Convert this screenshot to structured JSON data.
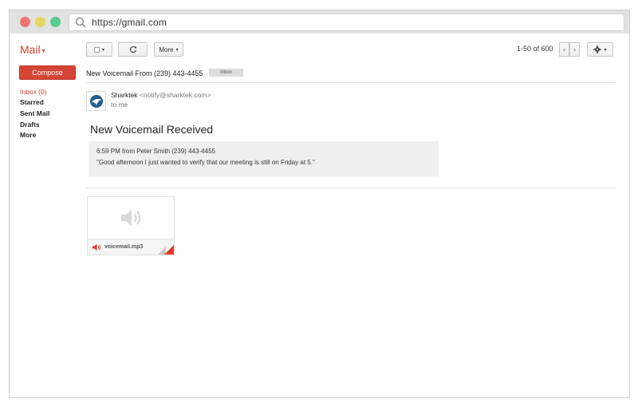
{
  "browser": {
    "url": "https://gmail.com"
  },
  "app": {
    "name": "Mail",
    "caret": "▾"
  },
  "toolbar": {
    "select_caret": "▾",
    "refresh_glyph": "⟳",
    "more_label": "More",
    "more_caret": "▾",
    "pager_text": "1-50 of 600",
    "prev_glyph": "‹",
    "next_glyph": "›",
    "settings_caret": "▾"
  },
  "sidebar": {
    "compose_label": "Compose",
    "items": [
      {
        "label": "Inbox (0)",
        "active": true
      },
      {
        "label": "Starred",
        "active": false
      },
      {
        "label": "Sent Mail",
        "active": false
      },
      {
        "label": "Drafts",
        "active": false
      },
      {
        "label": "More",
        "active": false
      }
    ]
  },
  "message": {
    "subject": "New Voicemail From (239) 443-4455",
    "label_tag": "Inbox",
    "sender_name": "Sharktek",
    "sender_email": "<notify@sharktek.com>",
    "recipient": "to me",
    "body_title": "New Voicemail Received",
    "voicemail_meta": "6:59 PM from Peter Smith (239) 443-4455",
    "voicemail_transcript": "\"Good afternoon I just wanted to verify that our meeting is still on Friday at 5.\""
  },
  "attachment": {
    "filename": "voicemail.mp3"
  },
  "colors": {
    "accent": "#d54535",
    "accent_text": "#d23f31",
    "titlebar": "#e2e2e2",
    "dot_red": "#ed7571",
    "dot_yellow": "#e6d663",
    "dot_green": "#56cc8c",
    "voicemail_box": "#efefef"
  },
  "icons": {
    "url_search": "search-icon",
    "refresh": "refresh-icon",
    "settings": "gear-icon",
    "avatar": "sharktek-logo-icon",
    "attachment_preview": "speaker-icon",
    "attachment_type": "speaker-small-icon"
  }
}
